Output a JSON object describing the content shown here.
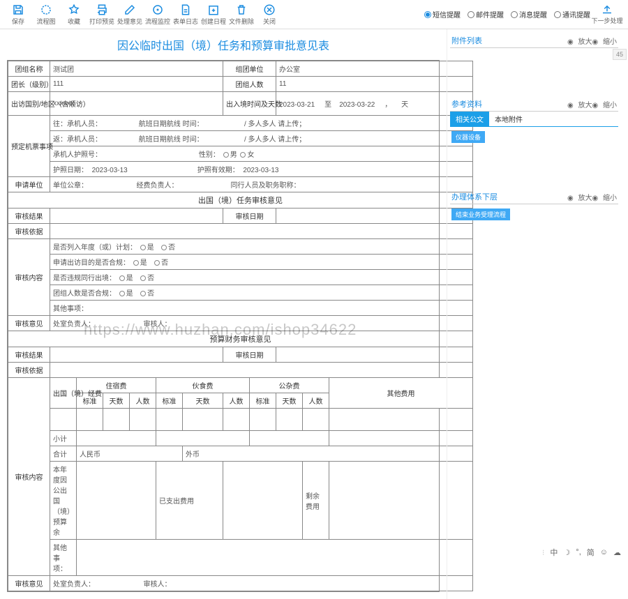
{
  "toolbar": {
    "items": [
      {
        "name": "save",
        "label": "保存"
      },
      {
        "name": "flow",
        "label": "流程图"
      },
      {
        "name": "fav",
        "label": "收藏"
      },
      {
        "name": "print",
        "label": "打印预览"
      },
      {
        "name": "opinion",
        "label": "处理意见"
      },
      {
        "name": "monitor",
        "label": "流程监控"
      },
      {
        "name": "formlog",
        "label": "表单日志"
      },
      {
        "name": "schedule",
        "label": "创建日程"
      },
      {
        "name": "delfile",
        "label": "文件删除"
      },
      {
        "name": "close",
        "label": "关闭"
      }
    ],
    "reminders": [
      {
        "name": "sms",
        "label": "短信提醒",
        "checked": true
      },
      {
        "name": "mail",
        "label": "邮件提醒",
        "checked": false
      },
      {
        "name": "msg",
        "label": "消息提醒",
        "checked": false
      },
      {
        "name": "comm",
        "label": "通讯提醒",
        "checked": false
      }
    ],
    "next_label": "下一步处理"
  },
  "title": "因公临时出国（境）任务和预算审批意见表",
  "form": {
    "r1": {
      "a": "团组名称",
      "b": "测试团",
      "c": "组团单位",
      "d": "办公室"
    },
    "r2": {
      "a": "团长（级别）",
      "b": "111",
      "c": "团组人数",
      "d": "11"
    },
    "r3": {
      "a": "出访国别/地区（含顺访）",
      "b": "xxxxxx",
      "c": "出入境时间及天数",
      "d_from": "2023-03-21",
      "d_mid": "至",
      "d_to": "2023-03-22",
      "d_days": "天"
    },
    "r4": {
      "a": "预定机票事项",
      "l1_p": "往：承机人员：",
      "l1_m": "航班日期航线 时间：",
      "l1_s": "/ 多人多人 请上传；",
      "l2_p": "返：承机人员：",
      "l2_m": "航班日期航线 时间：",
      "l2_s": "/ 多人多人 请上传；",
      "l3_a": "承机人护照号：",
      "l3_b": "性别：",
      "l3_c": "男",
      "l3_d": "女",
      "l4_a": "护照日期：",
      "l4_av": "2023-03-13",
      "l4_b": "护照有效期：",
      "l4_bv": "2023-03-13"
    },
    "r5": {
      "a": "申请单位",
      "b": "单位公章：",
      "c": "经费负责人：",
      "d": "同行人员及职务职称："
    },
    "s1": "出国（境）任务审核意见",
    "r6": {
      "a": "审核结果",
      "b": "",
      "c": "审核日期",
      "d": ""
    },
    "r7": {
      "a": "审核依据"
    },
    "r8": {
      "a": "审核内容",
      "l1": "是否列入年度（或）计划：",
      "y": "是",
      "n": "否",
      "l2": "申请出访目的是否合规：",
      "l3": "是否违规同行出境：",
      "l4": "团组人数是否合规："
    },
    "r9": {
      "a": "",
      "b": "其他事项："
    },
    "r10": {
      "a": "审核意见",
      "b": "处室负责人：",
      "c": "审核人："
    },
    "s2": "预算财务审核意见",
    "r11": {
      "a": "审核结果",
      "c": "审核日期"
    },
    "r12": {
      "a": "审核依据"
    },
    "r13": {
      "a": "审核内容",
      "b": "出国（境）经费",
      "h1": "住宿费",
      "h2": "伙食费",
      "h3": "公杂费",
      "h4": "其他费用",
      "hh1": "标准",
      "hh2": "天数",
      "hh3": "人数"
    },
    "r14": {
      "a": "小计"
    },
    "r15": {
      "a": "合计",
      "b": "人民币",
      "c": "外币"
    },
    "r16": {
      "a": "本年度因公出国（境）预算余",
      "b": "已支出费用",
      "c": "剩余费用"
    },
    "r17": {
      "a": "其他事项："
    },
    "r18": {
      "a": "审核意见",
      "b": "处室负责人：",
      "c": "审核人："
    }
  },
  "side": {
    "p1": {
      "title": "附件列表",
      "expand": "放大",
      "collapse": "缩小"
    },
    "p2": {
      "title": "参考资料",
      "expand": "放大",
      "collapse": "缩小",
      "tab1": "相关公文",
      "tab2": "本地附件",
      "chip": "仪器设备"
    },
    "p3": {
      "title": "办理体系下层",
      "expand": "放大",
      "collapse": "缩小",
      "chip": "结束业务受理流程"
    },
    "badge": "45"
  },
  "watermark": "https://www.huzhan.com/ishop34622",
  "statusbar": {
    "a": "中",
    "b": "简"
  }
}
